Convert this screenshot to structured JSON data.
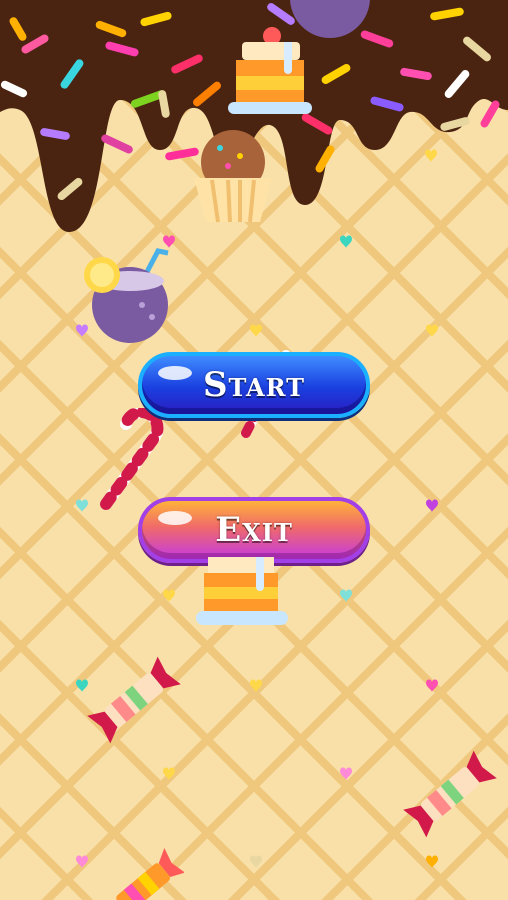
{
  "menu": {
    "start_label": "Start",
    "exit_label": "Exit"
  },
  "colors": {
    "chocolate": "#4a2411",
    "waffle": "#f8e0a8",
    "waffle_lines": "#efc77d",
    "start_button": "#1a3fe0",
    "exit_button": "#c43be0"
  },
  "decorations": [
    "sprinkles",
    "pancake-stack",
    "cupcake",
    "coconut-drink",
    "candy-cane",
    "wrapped-candy",
    "hearts"
  ]
}
